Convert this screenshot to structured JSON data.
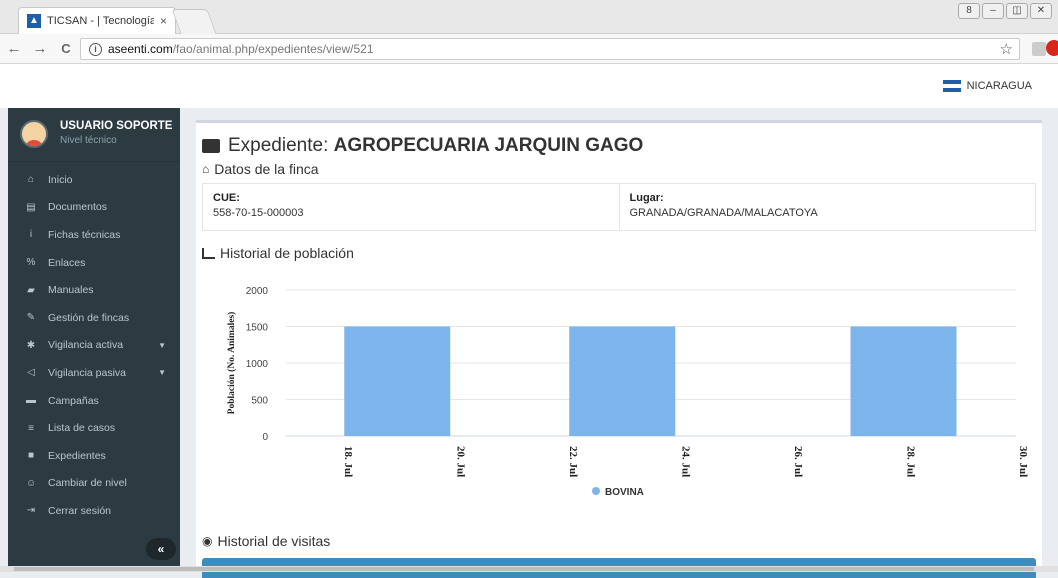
{
  "browser": {
    "tab_title": "TICSAN - | Tecnología de",
    "tab_close": "×",
    "url_host": "aseenti.com",
    "url_path": "/fao/animal.php/expedientes/view/521",
    "back": "←",
    "forward": "→",
    "reload": "C",
    "info": "i",
    "star": "☆",
    "win_controls": [
      "8",
      "–",
      "◫",
      "✕"
    ]
  },
  "topbar": {
    "country": "NICARAGUA"
  },
  "sidebar": {
    "user_name": "USUARIO SOPORTE",
    "user_level": "Nivel técnico",
    "items": [
      {
        "label": "Inicio",
        "icon": "home-icon",
        "glyph": "⌂"
      },
      {
        "label": "Documentos",
        "icon": "file-icon",
        "glyph": "▤"
      },
      {
        "label": "Fichas técnicas",
        "icon": "info-icon",
        "glyph": "i"
      },
      {
        "label": "Enlaces",
        "icon": "link-icon",
        "glyph": "%"
      },
      {
        "label": "Manuales",
        "icon": "book-icon",
        "glyph": "▰"
      },
      {
        "label": "Gestión de fincas",
        "icon": "edit-icon",
        "glyph": "✎"
      },
      {
        "label": "Vigilancia activa",
        "icon": "paw-icon",
        "glyph": "✱",
        "caret": true
      },
      {
        "label": "Vigilancia pasiva",
        "icon": "bullhorn-icon",
        "glyph": "◁",
        "caret": true
      },
      {
        "label": "Campañas",
        "icon": "flag-icon",
        "glyph": "▬"
      },
      {
        "label": "Lista de casos",
        "icon": "list-icon",
        "glyph": "≡"
      },
      {
        "label": "Expedientes",
        "icon": "folder-icon",
        "glyph": "■"
      },
      {
        "label": "Cambiar de nivel",
        "icon": "users-icon",
        "glyph": "☺"
      },
      {
        "label": "Cerrar sesión",
        "icon": "sign-out-icon",
        "glyph": "⇥"
      }
    ],
    "collapse": "«"
  },
  "main": {
    "title_prefix": "Expediente: ",
    "title_name": "AGROPECUARIA JARQUIN GAGO",
    "datos_heading": "Datos de la finca",
    "cue_label": "CUE:",
    "cue_value": "558-70-15-000003",
    "lugar_label": "Lugar:",
    "lugar_value": "GRANADA/GRANADA/MALACATOYA",
    "historial_poblacion": "Historial de población",
    "historial_visitas": "Historial de visitas"
  },
  "chart_data": {
    "type": "bar",
    "ylabel": "Población (No. Animales)",
    "ylim": [
      0,
      2000
    ],
    "yticks": [
      0,
      500,
      1000,
      1500,
      2000
    ],
    "xticks": [
      "18. Jul",
      "20. Jul",
      "22. Jul",
      "24. Jul",
      "26. Jul",
      "28. Jul",
      "30. Jul"
    ],
    "x_range_days": [
      18,
      30
    ],
    "series": [
      {
        "name": "BOVINA",
        "color": "#7cb5ec",
        "points": [
          {
            "day": 19,
            "value": 1500
          },
          {
            "day": 23,
            "value": 1500
          },
          {
            "day": 28,
            "value": 1500
          }
        ]
      }
    ],
    "legend_position": "bottom-center",
    "grid": true
  }
}
